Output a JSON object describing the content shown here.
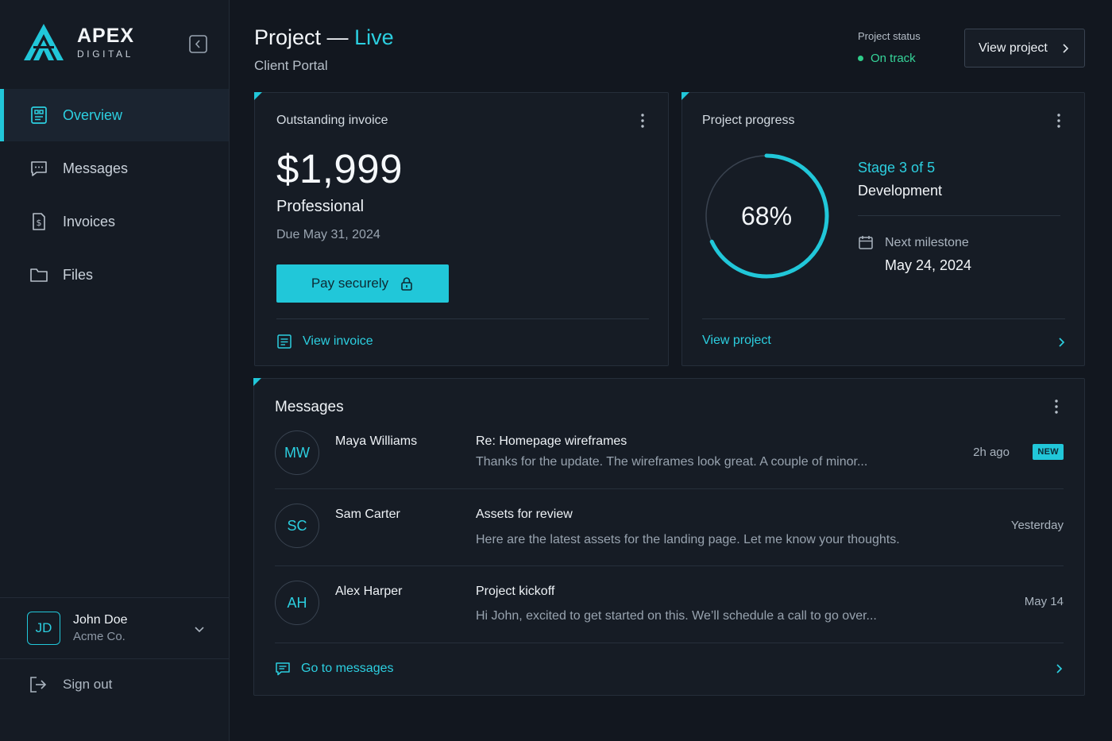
{
  "brand": {
    "name": "APEX",
    "sub": "DIGITAL"
  },
  "nav": {
    "items": [
      {
        "label": "Overview",
        "icon": "overview-icon",
        "active": true
      },
      {
        "label": "Messages",
        "icon": "chat-icon",
        "active": false
      },
      {
        "label": "Invoices",
        "icon": "invoice-icon",
        "active": false
      },
      {
        "label": "Files",
        "icon": "folder-icon",
        "active": false
      }
    ]
  },
  "user": {
    "initials": "JD",
    "name": "John Doe",
    "org": "Acme Co."
  },
  "signout_label": "Sign out",
  "header": {
    "title": "Project —",
    "title_live": "Live",
    "subtitle": "Client Portal",
    "status_label": "Project status",
    "status_value": "On track",
    "view_project_label": "View project"
  },
  "invoice": {
    "title": "Outstanding invoice",
    "amount": "$1,999",
    "plan": "Professional",
    "due": "Due May 31, 2024",
    "pay_label": "Pay securely",
    "link_label": "View invoice"
  },
  "progress": {
    "title": "Project progress",
    "percent": 68,
    "percent_label": "68%",
    "stage": "Stage 3 of 5",
    "stage_name": "Development",
    "milestone_label": "Next milestone",
    "milestone_date": "May 24, 2024",
    "link_label": "View project"
  },
  "messages": {
    "title": "Messages",
    "items": [
      {
        "initials": "MW",
        "name": "Maya Williams",
        "subject": "Re: Homepage wireframes",
        "preview": "Thanks for the update. The wireframes look great. A couple of minor...",
        "time": "2h ago",
        "badge": "NEW"
      },
      {
        "initials": "SC",
        "name": "Sam Carter",
        "subject": "Assets for review",
        "preview": "Here are the latest assets for the landing page. Let me know your thoughts.",
        "time": "Yesterday"
      },
      {
        "initials": "AH",
        "name": "Alex Harper",
        "subject": "Project kickoff",
        "preview": "Hi John, excited to get started on this. We’ll schedule a call to go over...",
        "time": "May 14"
      }
    ],
    "link_label": "Go to messages"
  },
  "colors": {
    "accent": "#21c7d9",
    "success": "#2ecc8a",
    "background": "#12171f",
    "card": "#161c25"
  }
}
